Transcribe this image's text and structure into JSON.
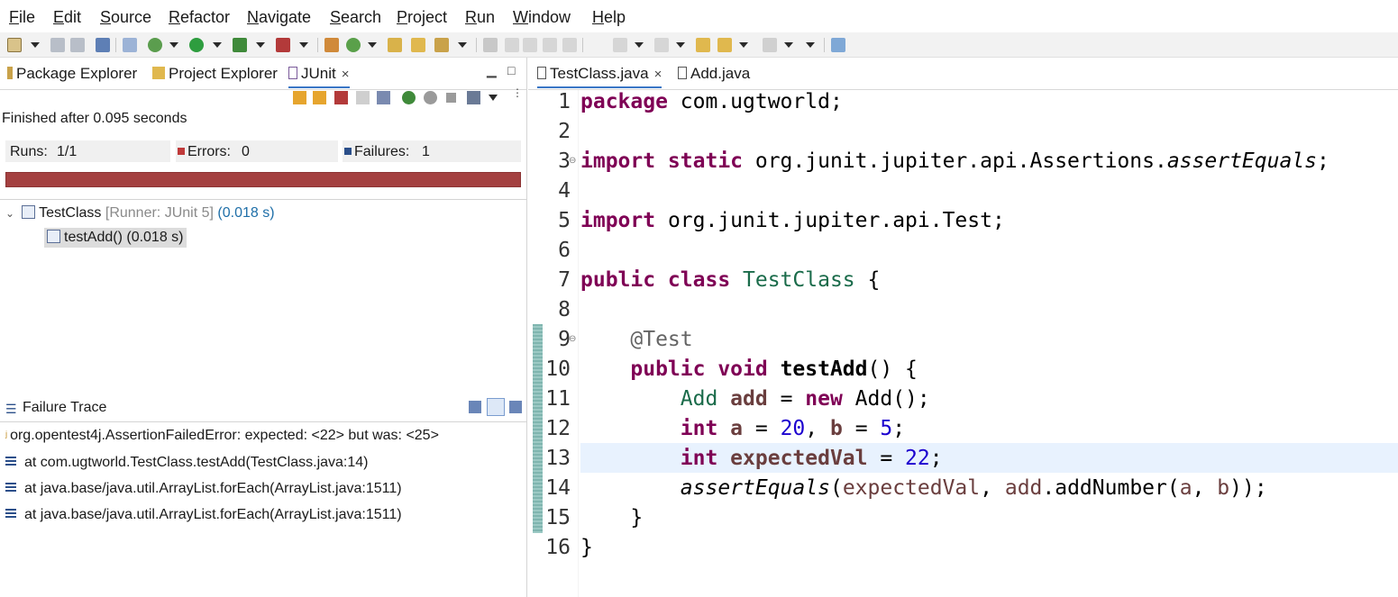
{
  "menubar": {
    "items": [
      "File",
      "Edit",
      "Source",
      "Refactor",
      "Navigate",
      "Search",
      "Project",
      "Run",
      "Window",
      "Help"
    ]
  },
  "left_panel": {
    "tabs": [
      {
        "label": "Package Explorer",
        "icon": "package-explorer-icon"
      },
      {
        "label": "Project Explorer",
        "icon": "project-explorer-icon"
      },
      {
        "label": "JUnit",
        "icon": "junit-icon",
        "active": true,
        "close": "×"
      }
    ],
    "status": "Finished after 0.095 seconds",
    "counters": {
      "runs_label": "Runs:",
      "runs_value": "1/1",
      "errors_label": "Errors:",
      "errors_value": "0",
      "failures_label": "Failures:",
      "failures_value": "1"
    },
    "progress": {
      "fraction": 1.0,
      "color": "#a44040"
    },
    "tree": {
      "root": {
        "name": "TestClass",
        "runner": "[Runner: JUnit 5]",
        "time": "(0.018 s)"
      },
      "child": {
        "name": "testAdd() (0.018 s)"
      }
    },
    "failure_trace": {
      "title": "Failure Trace",
      "lines": [
        "org.opentest4j.AssertionFailedError: expected: <22> but was: <25>",
        "at com.ugtworld.TestClass.testAdd(TestClass.java:14)",
        "at java.base/java.util.ArrayList.forEach(ArrayList.java:1511)",
        "at java.base/java.util.ArrayList.forEach(ArrayList.java:1511)"
      ]
    }
  },
  "editor": {
    "tabs": [
      {
        "label": "TestClass.java",
        "close": "×",
        "active": true
      },
      {
        "label": "Add.java"
      }
    ],
    "line_numbers": [
      "1",
      "2",
      "3",
      "4",
      "5",
      "6",
      "7",
      "8",
      "9",
      "10",
      "11",
      "12",
      "13",
      "14",
      "15",
      "16"
    ],
    "current_line": 13,
    "code": {
      "l1_kw": "package",
      "l1_rest": " com.ugtworld;",
      "l3_kw": "import static",
      "l3_rest": " org.junit.jupiter.api.Assertions.",
      "l3_method": "assertEquals",
      "l3_end": ";",
      "l5_kw": "import",
      "l5_rest": " org.junit.jupiter.api.Test;",
      "l7_kw": "public class",
      "l7_cls": " TestClass",
      "l7_end": " {",
      "l9_ann": "    @Test",
      "l10_kw": "    public void",
      "l10_name": " testAdd",
      "l10_end": "() {",
      "l11_type": "        Add",
      "l11_var": " add",
      "l11_eq": " = ",
      "l11_new": "new",
      "l11_rest": " Add();",
      "l12_kw": "        int",
      "l12_a": " a",
      "l12_eq": " = ",
      "l12_n1": "20",
      "l12_comma": ", ",
      "l12_b": "b",
      "l12_eq2": " = ",
      "l12_n2": "5",
      "l12_end": ";",
      "l13_kw": "        int",
      "l13_var": " expectedVal",
      "l13_eq": " = ",
      "l13_num": "22",
      "l13_end": ";",
      "l14_method": "        assertEquals",
      "l14_p1": "(",
      "l14_arg1": "expectedVal",
      "l14_p2": ", ",
      "l14_obj": "add",
      "l14_dot": ".addNumber(",
      "l14_a": "a",
      "l14_c": ", ",
      "l14_b": "b",
      "l14_end": "));",
      "l15": "    }",
      "l16": "}"
    }
  },
  "colors": {
    "keyword": "#7f0055",
    "class": "#1a6b4a",
    "number": "#1c00cf",
    "variable": "#6a3e3e",
    "annotation": "#646464",
    "failure_bar": "#a44040"
  }
}
